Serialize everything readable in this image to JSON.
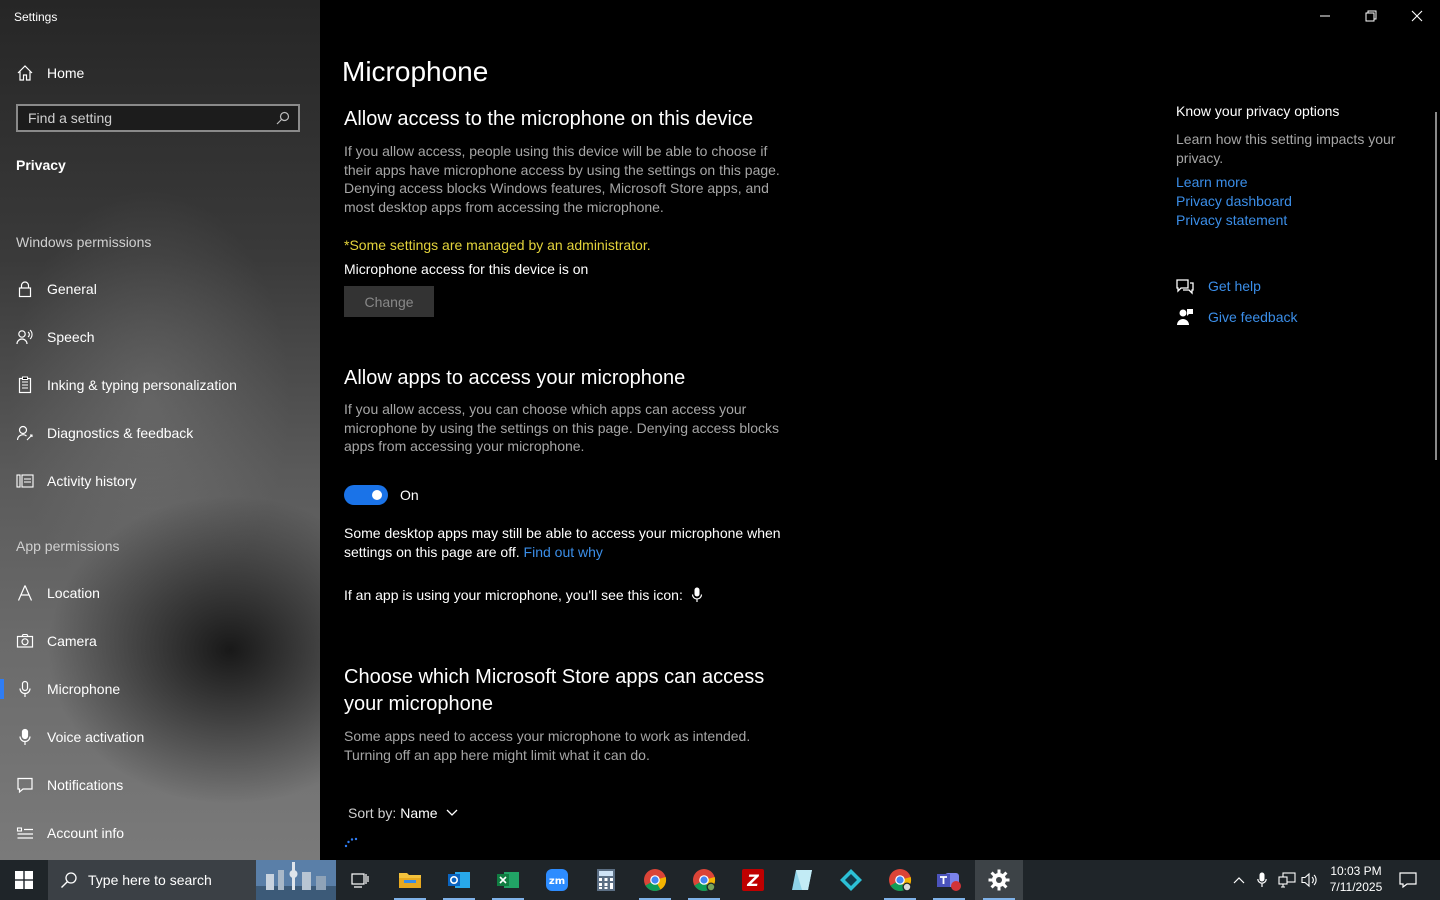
{
  "window": {
    "app_title": "Settings",
    "controls": [
      "minimize",
      "restore",
      "close"
    ]
  },
  "sidebar": {
    "home_label": "Home",
    "search_placeholder": "Find a setting",
    "section_title": "Privacy",
    "groups": [
      {
        "heading": "Windows permissions",
        "items": [
          {
            "label": "General",
            "icon": "lock-icon"
          },
          {
            "label": "Speech",
            "icon": "speech-icon"
          },
          {
            "label": "Inking & typing personalization",
            "icon": "clipboard-icon"
          },
          {
            "label": "Diagnostics & feedback",
            "icon": "diagnostics-icon"
          },
          {
            "label": "Activity history",
            "icon": "activity-icon"
          }
        ]
      },
      {
        "heading": "App permissions",
        "items": [
          {
            "label": "Location",
            "icon": "location-icon"
          },
          {
            "label": "Camera",
            "icon": "camera-icon"
          },
          {
            "label": "Microphone",
            "icon": "microphone-icon",
            "selected": true
          },
          {
            "label": "Voice activation",
            "icon": "voice-activation-icon"
          },
          {
            "label": "Notifications",
            "icon": "notifications-icon"
          },
          {
            "label": "Account info",
            "icon": "account-info-icon"
          }
        ]
      }
    ]
  },
  "main": {
    "title": "Microphone",
    "device_section": {
      "heading": "Allow access to the microphone on this device",
      "description": "If you allow access, people using this device will be able to choose if their apps have microphone access by using the settings on this page. Denying access blocks Windows features, Microsoft Store apps, and most desktop apps from accessing the microphone.",
      "admin_notice": "*Some settings are managed by an administrator.",
      "status": "Microphone access for this device is on",
      "change_button": "Change"
    },
    "apps_section": {
      "heading": "Allow apps to access your microphone",
      "description": "If you allow access, you can choose which apps can access your microphone by using the settings on this page. Denying access blocks apps from accessing your microphone.",
      "toggle_state": "On",
      "toggle_on": true,
      "desktop_note": "Some desktop apps may still be able to access your microphone when settings on this page are off.",
      "find_out_link": "Find out why",
      "icon_note": "If an app is using your microphone, you'll see this icon:"
    },
    "store_section": {
      "heading": "Choose which Microsoft Store apps can access your microphone",
      "description": "Some apps need to access your microphone to work as intended. Turning off an app here might limit what it can do.",
      "sort_label": "Sort by:",
      "sort_value": "Name"
    }
  },
  "right_panel": {
    "heading": "Know your privacy options",
    "description": "Learn how this setting impacts your privacy.",
    "links": [
      "Learn more",
      "Privacy dashboard",
      "Privacy statement"
    ],
    "get_help": "Get help",
    "give_feedback": "Give feedback"
  },
  "taskbar": {
    "search_placeholder": "Type here to search",
    "apps": [
      {
        "name": "task-view-icon"
      },
      {
        "name": "file-explorer-icon",
        "running": true
      },
      {
        "name": "outlook-icon",
        "running": true
      },
      {
        "name": "excel-icon",
        "running": true
      },
      {
        "name": "zoom-icon",
        "running": false
      },
      {
        "name": "calculator-icon",
        "running": false
      },
      {
        "name": "chrome-icon",
        "running": true
      },
      {
        "name": "chrome-profile-icon",
        "running": true
      },
      {
        "name": "filezilla-icon",
        "running": false
      },
      {
        "name": "notepad-icon",
        "running": false
      },
      {
        "name": "app-diamond-icon",
        "running": false
      },
      {
        "name": "chrome-profile2-icon",
        "running": true
      },
      {
        "name": "teams-icon",
        "running": true
      },
      {
        "name": "settings-icon",
        "running": true,
        "active": true
      }
    ],
    "time": "10:03 PM",
    "date": "7/11/2025"
  },
  "colors": {
    "accent": "#1a73e8",
    "link": "#3b8ee8",
    "warning": "#e3d33b"
  }
}
